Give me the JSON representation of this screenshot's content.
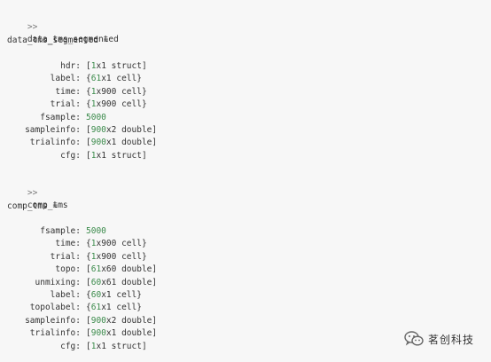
{
  "block1": {
    "prompt": ">>",
    "command": "data_tms_segmented",
    "var_line": "data_tms_segmented =",
    "fields": [
      {
        "name": "hdr:",
        "open": "[",
        "num": "1",
        "rest": "x1 struct",
        "close": "]"
      },
      {
        "name": "label:",
        "open": "{",
        "num": "61",
        "rest": "x1 cell",
        "close": "}"
      },
      {
        "name": "time:",
        "open": "{",
        "num": "1",
        "rest": "x900 cell",
        "close": "}"
      },
      {
        "name": "trial:",
        "open": "{",
        "num": "1",
        "rest": "x900 cell",
        "close": "}"
      },
      {
        "name": "fsample:",
        "open": "",
        "num": "5000",
        "rest": "",
        "close": ""
      },
      {
        "name": "sampleinfo:",
        "open": "[",
        "num": "900",
        "rest": "x2 double",
        "close": "]"
      },
      {
        "name": "trialinfo:",
        "open": "[",
        "num": "900",
        "rest": "x1 double",
        "close": "]"
      },
      {
        "name": "cfg:",
        "open": "[",
        "num": "1",
        "rest": "x1 struct",
        "close": "]"
      }
    ]
  },
  "block2": {
    "prompt": ">>",
    "command": "comp_tms",
    "var_line": "comp_tms =",
    "fields": [
      {
        "name": "fsample:",
        "open": "",
        "num": "5000",
        "rest": "",
        "close": ""
      },
      {
        "name": "time:",
        "open": "{",
        "num": "1",
        "rest": "x900 cell",
        "close": "}"
      },
      {
        "name": "trial:",
        "open": "{",
        "num": "1",
        "rest": "x900 cell",
        "close": "}"
      },
      {
        "name": "topo:",
        "open": "[",
        "num": "61",
        "rest": "x60 double",
        "close": "]"
      },
      {
        "name": "unmixing:",
        "open": "[",
        "num": "60",
        "rest": "x61 double",
        "close": "]"
      },
      {
        "name": "label:",
        "open": "{",
        "num": "60",
        "rest": "x1 cell",
        "close": "}"
      },
      {
        "name": "topolabel:",
        "open": "{",
        "num": "61",
        "rest": "x1 cell",
        "close": "}"
      },
      {
        "name": "sampleinfo:",
        "open": "[",
        "num": "900",
        "rest": "x2 double",
        "close": "]"
      },
      {
        "name": "trialinfo:",
        "open": "[",
        "num": "900",
        "rest": "x1 double",
        "close": "]"
      },
      {
        "name": "cfg:",
        "open": "[",
        "num": "1",
        "rest": "x1 struct",
        "close": "]"
      }
    ]
  },
  "watermark": {
    "icon": "wechat-icon",
    "text": "茗创科技",
    "icon_color": "#666666"
  },
  "colors": {
    "background": "#f7f7f7",
    "text": "#333333",
    "number": "#3a8a4a",
    "prompt": "#7a7a7a"
  }
}
